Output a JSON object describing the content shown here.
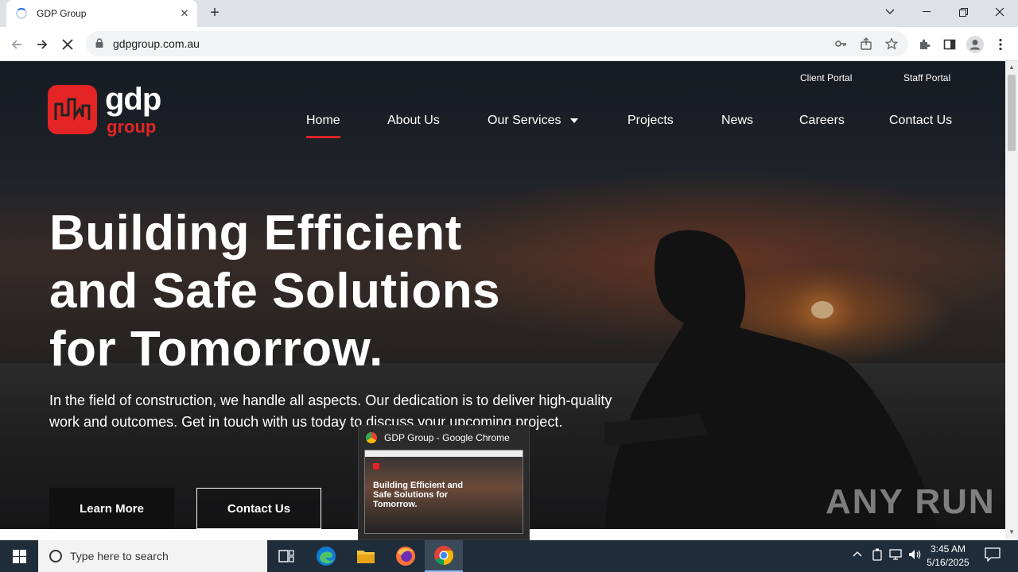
{
  "browser": {
    "tab_title": "GDP Group",
    "url": "gdpgroup.com.au"
  },
  "site": {
    "logo": {
      "word1": "gdp",
      "word2": "group"
    },
    "portals": [
      "Client Portal",
      "Staff Portal"
    ],
    "nav": [
      "Home",
      "About Us",
      "Our Services",
      "Projects",
      "News",
      "Careers",
      "Contact Us"
    ],
    "active_nav": "Home",
    "hero": {
      "line1": "Building Efficient",
      "line2": "and Safe Solutions",
      "line3": "for Tomorrow.",
      "subtitle": "In the field of construction, we handle all aspects. Our dedication is to deliver high-quality work and outcomes. Get in touch with us today to discuss your upcoming project.",
      "btn_primary": "Learn More",
      "btn_secondary": "Contact Us"
    },
    "watermark": "ANY RUN"
  },
  "preview": {
    "title": "GDP Group - Google Chrome",
    "thumb_text": "Building Efficient and Safe Solutions for Tomorrow."
  },
  "taskbar": {
    "search_placeholder": "Type here to search",
    "time": "3:45 AM",
    "date": "5/16/2025"
  },
  "colors": {
    "brand_red": "#e52525",
    "taskbar": "#1f2d3a"
  }
}
